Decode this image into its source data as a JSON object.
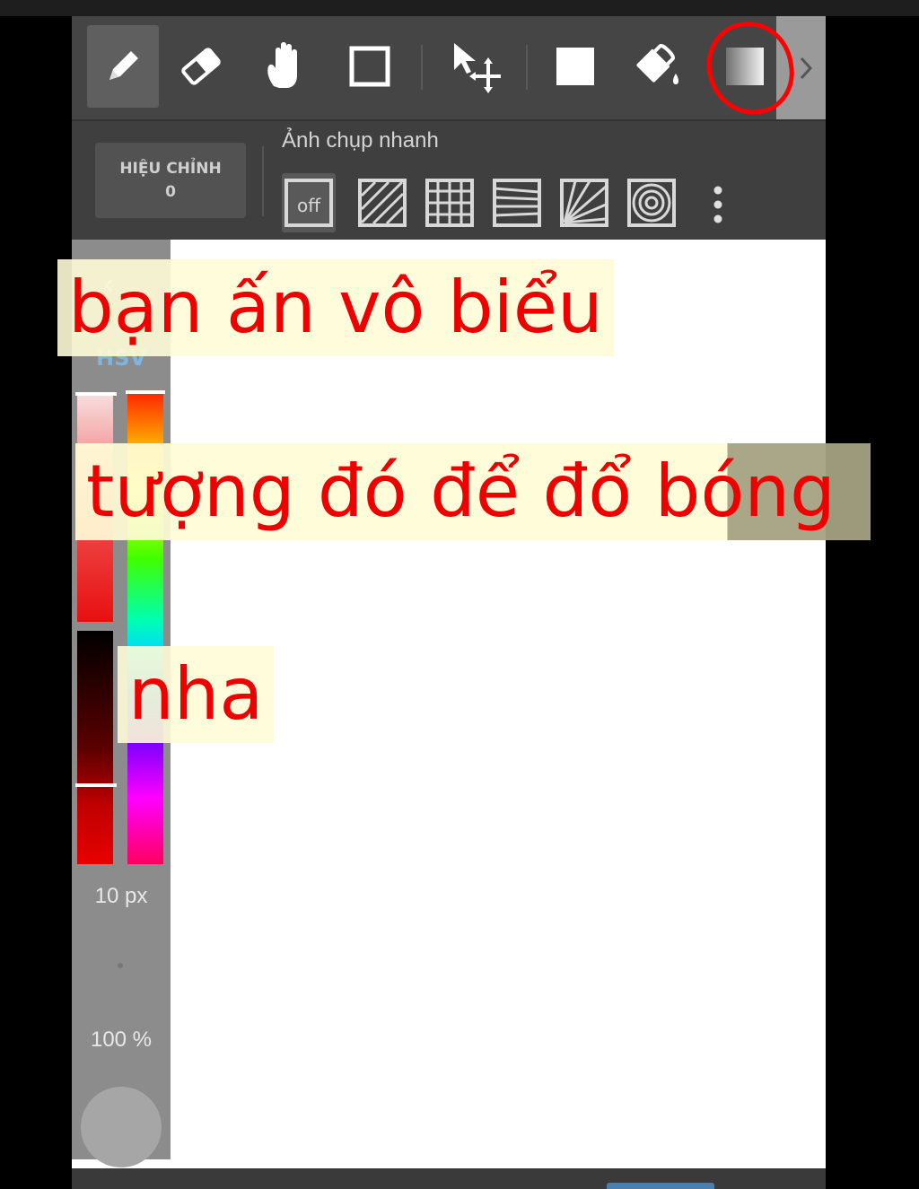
{
  "toolbar": {
    "tools": [
      {
        "name": "pen",
        "icon": "pencil-icon",
        "active": true
      },
      {
        "name": "eraser",
        "icon": "eraser-icon"
      },
      {
        "name": "hand",
        "icon": "hand-icon"
      },
      {
        "name": "select-rect",
        "icon": "selection-rectangle-icon"
      },
      {
        "name": "move",
        "icon": "move-icon"
      },
      {
        "name": "fill-rect",
        "icon": "filled-rectangle-icon"
      },
      {
        "name": "bucket",
        "icon": "paint-bucket-icon"
      },
      {
        "name": "gradient",
        "icon": "gradient-icon",
        "highlighted": true
      }
    ],
    "more_icon": "chevron-right-icon"
  },
  "snapshot": {
    "adjust_label": "HIỆU CHỈNH",
    "adjust_value": "0",
    "label": "Ảnh chụp nhanh",
    "off_label": "off",
    "options": [
      "parallel-lines-icon",
      "grid-icon",
      "perspective-lines-icon",
      "radial-lines-icon",
      "concentric-circles-icon"
    ],
    "more_icon": "more-vertical-icon"
  },
  "side_panel": {
    "back_icon": "chevron-left-icon",
    "mode_label": "HSV",
    "brush_size": "10 px",
    "opacity": "100 %"
  },
  "captions": {
    "line1": "bạn ấn vô biểu",
    "line2": "tượng đó để đổ bóng",
    "line3": "nha"
  },
  "colors": {
    "toolbar_bg": "#454545",
    "annotation_red": "#ee0000",
    "hsv_label": "#7fb4e0"
  }
}
